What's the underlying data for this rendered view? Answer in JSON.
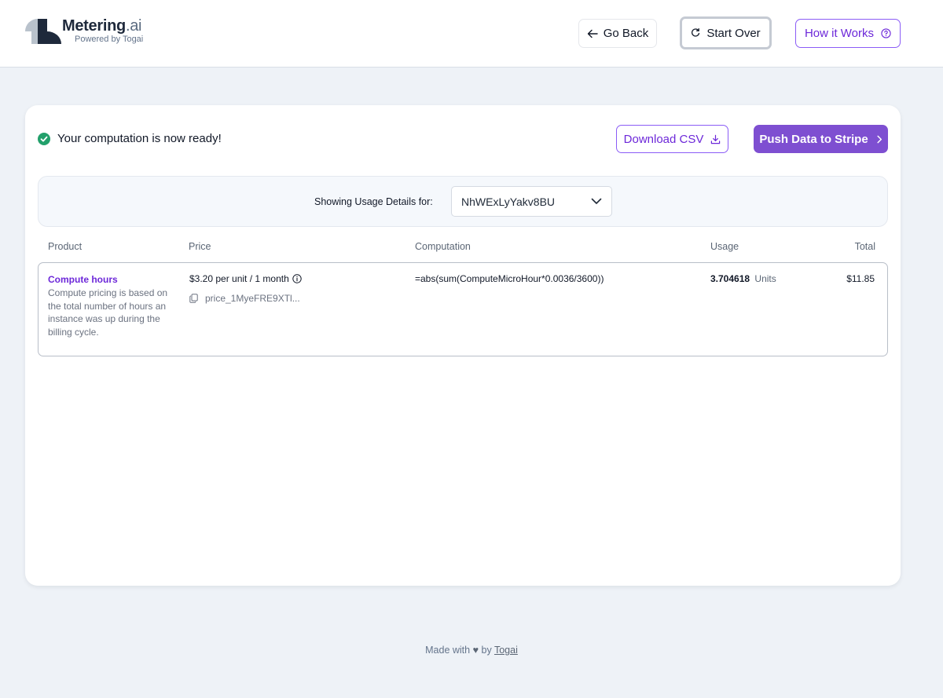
{
  "brand": {
    "name": "Metering",
    "name_suffix": ".ai",
    "tagline": "Powered by Togai"
  },
  "header": {
    "back_label": "Go Back",
    "start_over_label": "Start Over",
    "how_label": "How it Works"
  },
  "status": {
    "message": "Your computation is now ready!"
  },
  "actions": {
    "download_label": "Download CSV",
    "push_label": "Push Data to Stripe"
  },
  "filter": {
    "label": "Showing Usage Details for:",
    "selected": "NhWExLyYakv8BU"
  },
  "table": {
    "columns": [
      "Product",
      "Price",
      "Computation",
      "Usage",
      "Total"
    ],
    "rows": [
      {
        "product": "Compute hours",
        "description": "Compute pricing is based on the total number of hours an instance was up during the billing cycle.",
        "price": "$3.20 per unit / 1 month",
        "price_id": "price_1MyeFRE9XTl...",
        "computation": "=abs(sum(ComputeMicroHour*0.0036/3600))",
        "usage_value": "3.704618",
        "usage_unit": "Units",
        "total": "$11.85"
      }
    ]
  },
  "footer": {
    "prefix": "Made with",
    "by": "by",
    "link": "Togai"
  },
  "colors": {
    "accent": "#7e4fd1",
    "accent_text": "#6d28d9",
    "success": "#22a06b",
    "page_bg": "#eef2f7"
  }
}
